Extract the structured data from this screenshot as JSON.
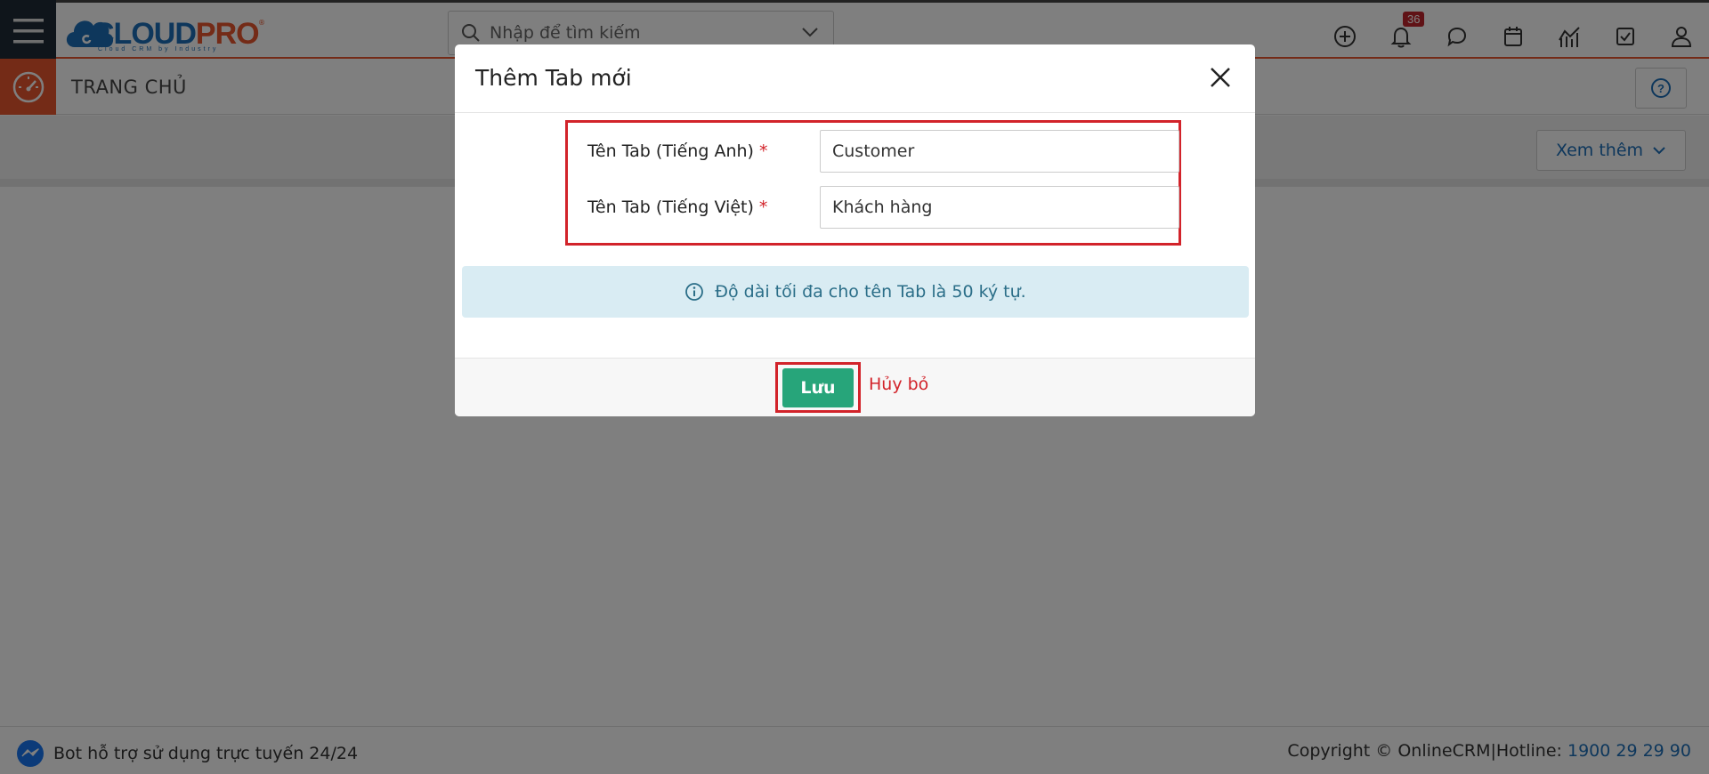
{
  "header": {
    "logo_text_1": "CLOUD",
    "logo_text_2": "PRO",
    "logo_tagline": "Cloud CRM by Industry",
    "search_placeholder": "Nhập để tìm kiếm",
    "notification_count": "36"
  },
  "breadcrumb": {
    "title": "TRANG CHỦ"
  },
  "toolbar": {
    "more_label": "Xem thêm"
  },
  "footer": {
    "bot_text": "Bot hỗ trợ sử dụng trực tuyến 24/24",
    "copyright": "Copyright © OnlineCRM|Hotline: ",
    "hotline": "1900 29 29 90"
  },
  "modal": {
    "title": "Thêm Tab mới",
    "fields": [
      {
        "label": "Tên Tab (Tiếng Anh)",
        "required_mark": "*",
        "value": "Customer"
      },
      {
        "label": "Tên Tab (Tiếng Việt)",
        "required_mark": "*",
        "value": "Khách hàng"
      }
    ],
    "info_text": "Độ dài tối đa cho tên Tab là 50 ký tự.",
    "save_label": "Lưu",
    "cancel_label": "Hủy bỏ"
  },
  "colors": {
    "brand_blue": "#1d6fb8",
    "brand_orange": "#e8572f",
    "save_green": "#27a57a",
    "highlight_red": "#d2232a",
    "info_bg": "#d9ecf3"
  },
  "icons": [
    "menu-icon",
    "search-icon",
    "chevron-down-icon",
    "plus-circle-icon",
    "bell-icon",
    "chat-icon",
    "calendar-icon",
    "chart-icon",
    "checkbox-icon",
    "user-icon",
    "dashboard-icon",
    "help-icon",
    "close-icon",
    "info-icon",
    "messenger-icon"
  ]
}
